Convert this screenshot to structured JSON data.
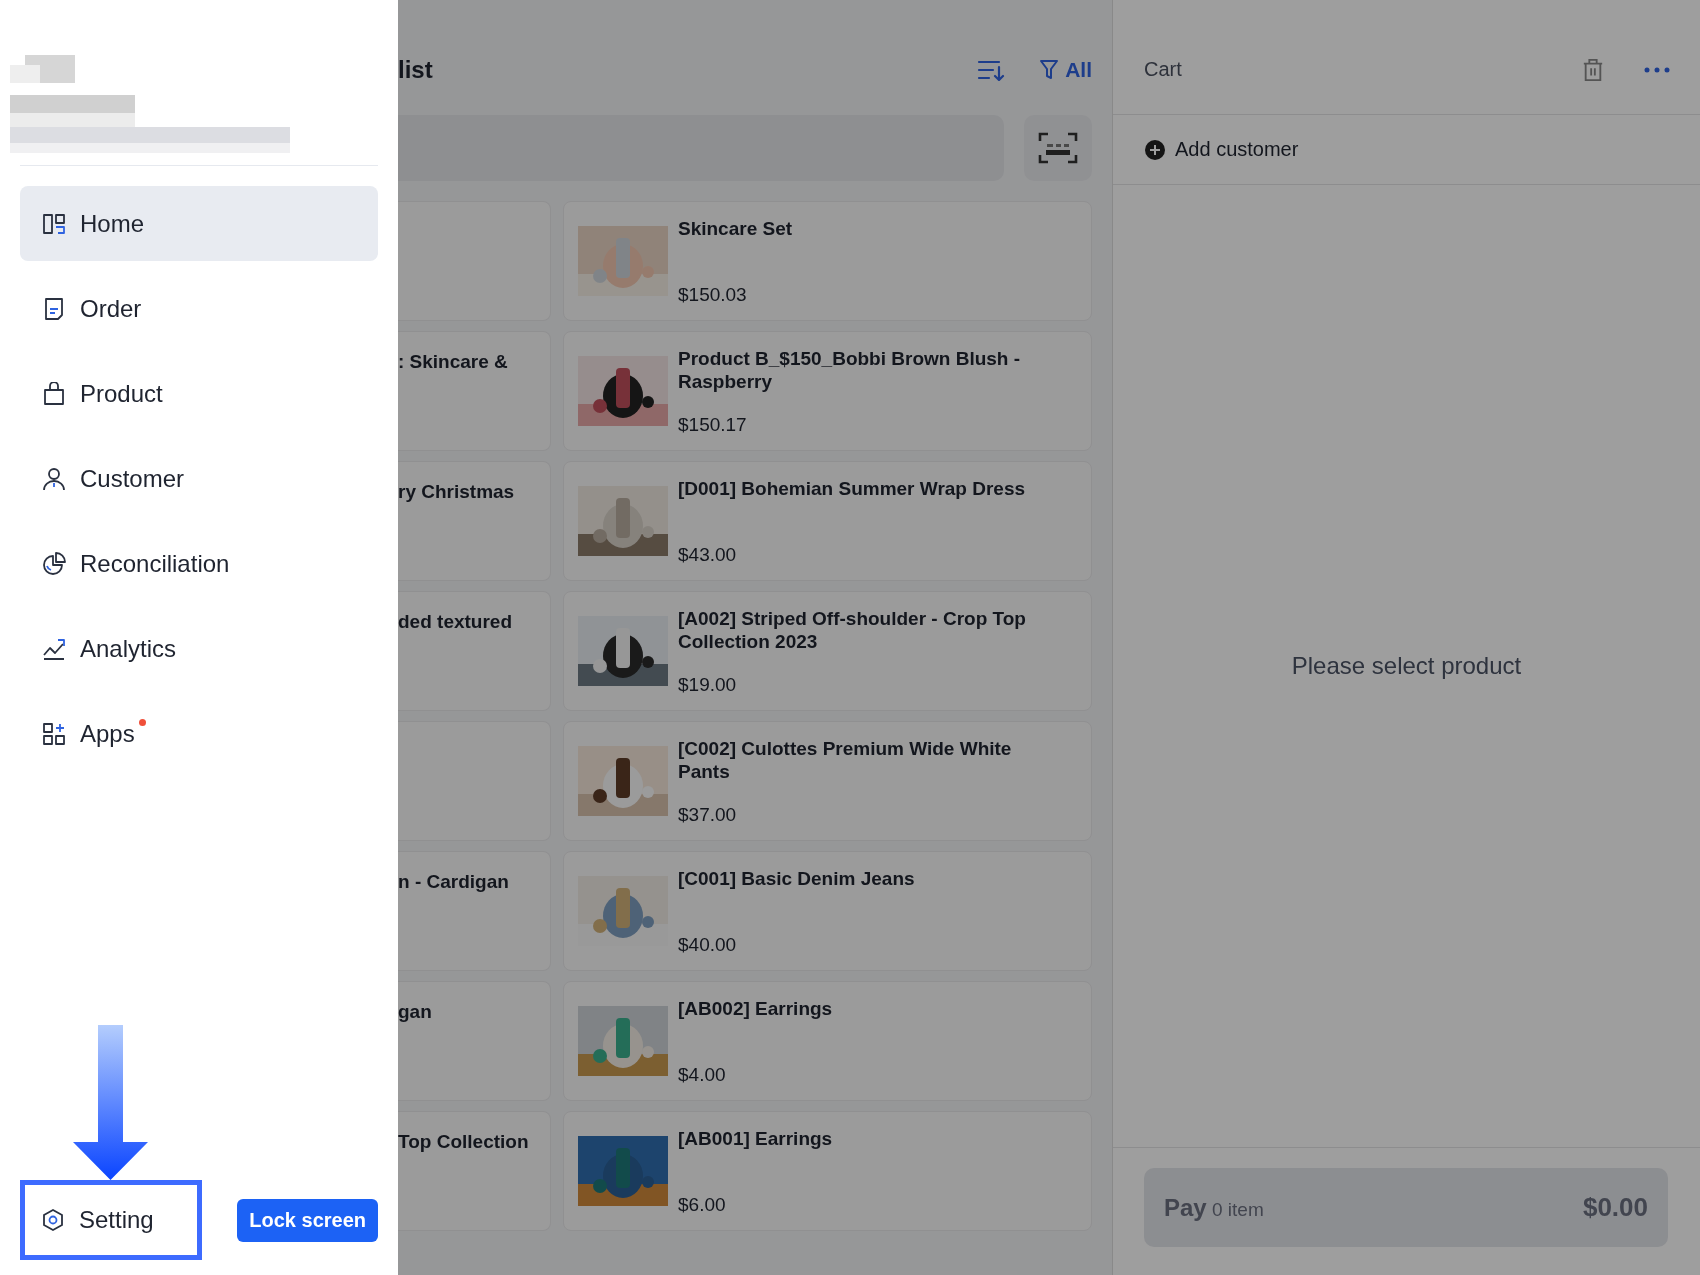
{
  "product_list": {
    "title": "list",
    "filter_label": "All",
    "products": [
      {
        "name": "Skincare Set",
        "price": "$150.03"
      },
      {
        "cut_name": ": Skincare &",
        "name": "Product B_$150_Bobbi Brown Blush - Raspberry",
        "price": "$150.17"
      },
      {
        "cut_name": "ry Christmas",
        "name": "[D001] Bohemian Summer Wrap Dress",
        "price": "$43.00"
      },
      {
        "cut_name": "ded textured",
        "name": "[A002] Striped Off-shoulder - Crop Top Collection 2023",
        "price": "$19.00"
      },
      {
        "name": "[C002] Culottes Premium Wide White Pants",
        "price": "$37.00"
      },
      {
        "cut_name": "n - Cardigan",
        "name": "[C001] Basic Denim Jeans",
        "price": "$40.00"
      },
      {
        "cut_name": "gan",
        "name": "[AB002] Earrings",
        "price": "$4.00"
      },
      {
        "cut_name": "Top Collection",
        "name": "[AB001] Earrings",
        "price": "$6.00"
      }
    ]
  },
  "cart": {
    "title": "Cart",
    "add_customer": "Add customer",
    "empty_message": "Please select product",
    "pay_label": "Pay",
    "item_count": "0 item",
    "total": "$0.00"
  },
  "drawer": {
    "items": [
      {
        "label": "Home",
        "selected": true,
        "badge": false
      },
      {
        "label": "Order",
        "selected": false,
        "badge": false
      },
      {
        "label": "Product",
        "selected": false,
        "badge": false
      },
      {
        "label": "Customer",
        "selected": false,
        "badge": false
      },
      {
        "label": "Reconciliation",
        "selected": false,
        "badge": false
      },
      {
        "label": "Analytics",
        "selected": false,
        "badge": false
      },
      {
        "label": "Apps",
        "selected": false,
        "badge": true
      }
    ],
    "setting": {
      "label": "Setting",
      "highlighted": true
    },
    "lock_button": "Lock screen"
  }
}
